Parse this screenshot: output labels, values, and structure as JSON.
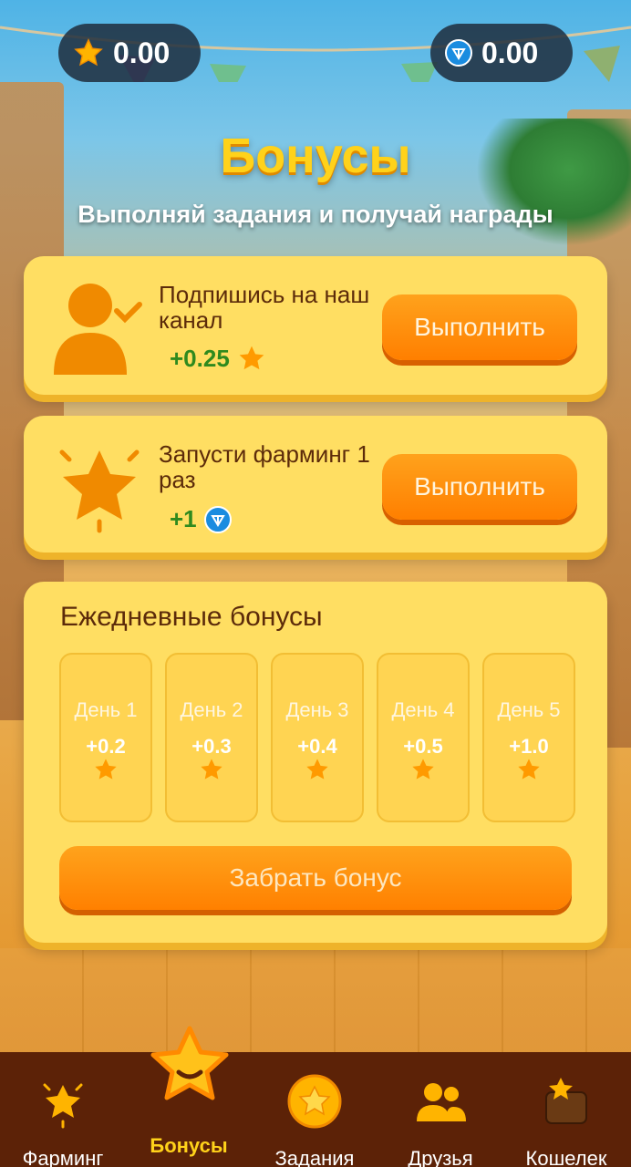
{
  "balances": {
    "stars": "0.00",
    "ton": "0.00"
  },
  "header": {
    "title": "Бонусы",
    "subtitle": "Выполняй задания и получай награды"
  },
  "tasks": [
    {
      "title": "Подпишись на наш канал",
      "reward": "+0.25",
      "reward_icon": "star-icon",
      "button": "Выполнить"
    },
    {
      "title": "Запусти фарминг 1 раз",
      "reward": "+1",
      "reward_icon": "ton-icon",
      "button": "Выполнить"
    }
  ],
  "daily": {
    "title": "Ежедневные бонусы",
    "days": [
      {
        "label": "День 1",
        "amount": "+0.2"
      },
      {
        "label": "День 2",
        "amount": "+0.3"
      },
      {
        "label": "День 3",
        "amount": "+0.4"
      },
      {
        "label": "День 4",
        "amount": "+0.5"
      },
      {
        "label": "День 5",
        "amount": "+1.0"
      }
    ],
    "claim_button": "Забрать бонус"
  },
  "nav": {
    "items": [
      {
        "label": "Фарминг",
        "icon": "farming-star-icon"
      },
      {
        "label": "Бонусы",
        "icon": "smiling-star-icon",
        "active": true
      },
      {
        "label": "Задания",
        "icon": "star-coin-icon"
      },
      {
        "label": "Друзья",
        "icon": "friends-icon"
      },
      {
        "label": "Кошелек",
        "icon": "wallet-icon"
      }
    ]
  },
  "colors": {
    "accent_yellow": "#ffd21a",
    "button_orange": "#ff8000",
    "card_bg": "#ffde62",
    "nav_bg": "#5c2207",
    "reward_green": "#2f8a1e",
    "ton_blue": "#1a8ce0"
  }
}
